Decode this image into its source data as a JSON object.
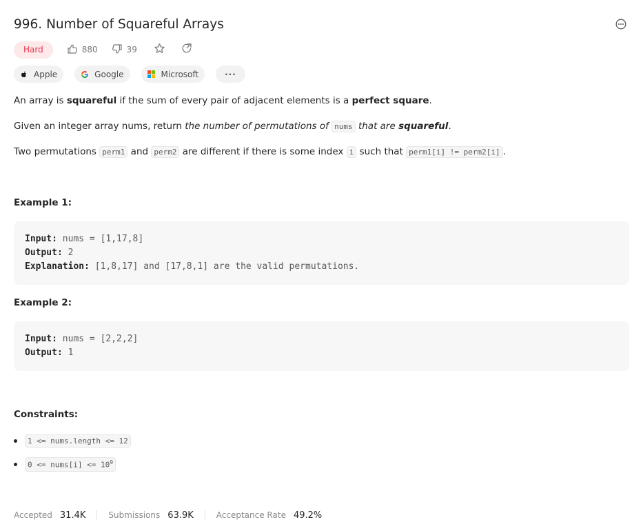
{
  "problem": {
    "title": "996. Number of Squareful Arrays",
    "difficulty": "Hard",
    "likes": "880",
    "dislikes": "39"
  },
  "tags": [
    {
      "label": "Apple",
      "icon": "apple-icon"
    },
    {
      "label": "Google",
      "icon": "google-icon"
    },
    {
      "label": "Microsoft",
      "icon": "microsoft-icon"
    }
  ],
  "tags_more": "···",
  "description": {
    "p1": {
      "t1": "An array is ",
      "b1": "squareful",
      "t2": " if the sum of every pair of adjacent elements is a ",
      "b2": "perfect square",
      "t3": "."
    },
    "p2": {
      "t1": "Given an integer array nums, return ",
      "i1": "the number of permutations of ",
      "c1": "nums",
      "i2": " that are ",
      "bi1": "squareful",
      "t2": "."
    },
    "p3": {
      "t1": "Two permutations ",
      "c1": "perm1",
      "t2": " and ",
      "c2": "perm2",
      "t3": " are different if there is some index ",
      "c3": "i",
      "t4": " such that ",
      "c4": "perm1[i] != perm2[i]",
      "t5": "."
    }
  },
  "examples": [
    {
      "title": "Example 1:",
      "input_label": "Input:",
      "input": " nums = [1,17,8]",
      "output_label": "Output:",
      "output": " 2",
      "explanation_label": "Explanation:",
      "explanation": " [1,8,17] and [17,8,1] are the valid permutations."
    },
    {
      "title": "Example 2:",
      "input_label": "Input:",
      "input": " nums = [2,2,2]",
      "output_label": "Output:",
      "output": " 1"
    }
  ],
  "constraints": {
    "title": "Constraints:",
    "c1": "1 <= nums.length <= 12",
    "c2_base": "0 <= nums[i] <= 10",
    "c2_sup": "9"
  },
  "footer": {
    "accepted_label": "Accepted",
    "accepted": "31.4K",
    "submissions_label": "Submissions",
    "submissions": "63.9K",
    "rate_label": "Acceptance Rate",
    "rate": "49.2%"
  },
  "colors": {
    "hard": "#e5394c",
    "hard_bg": "#fde8ea",
    "code_bg": "#f7f7f8"
  }
}
